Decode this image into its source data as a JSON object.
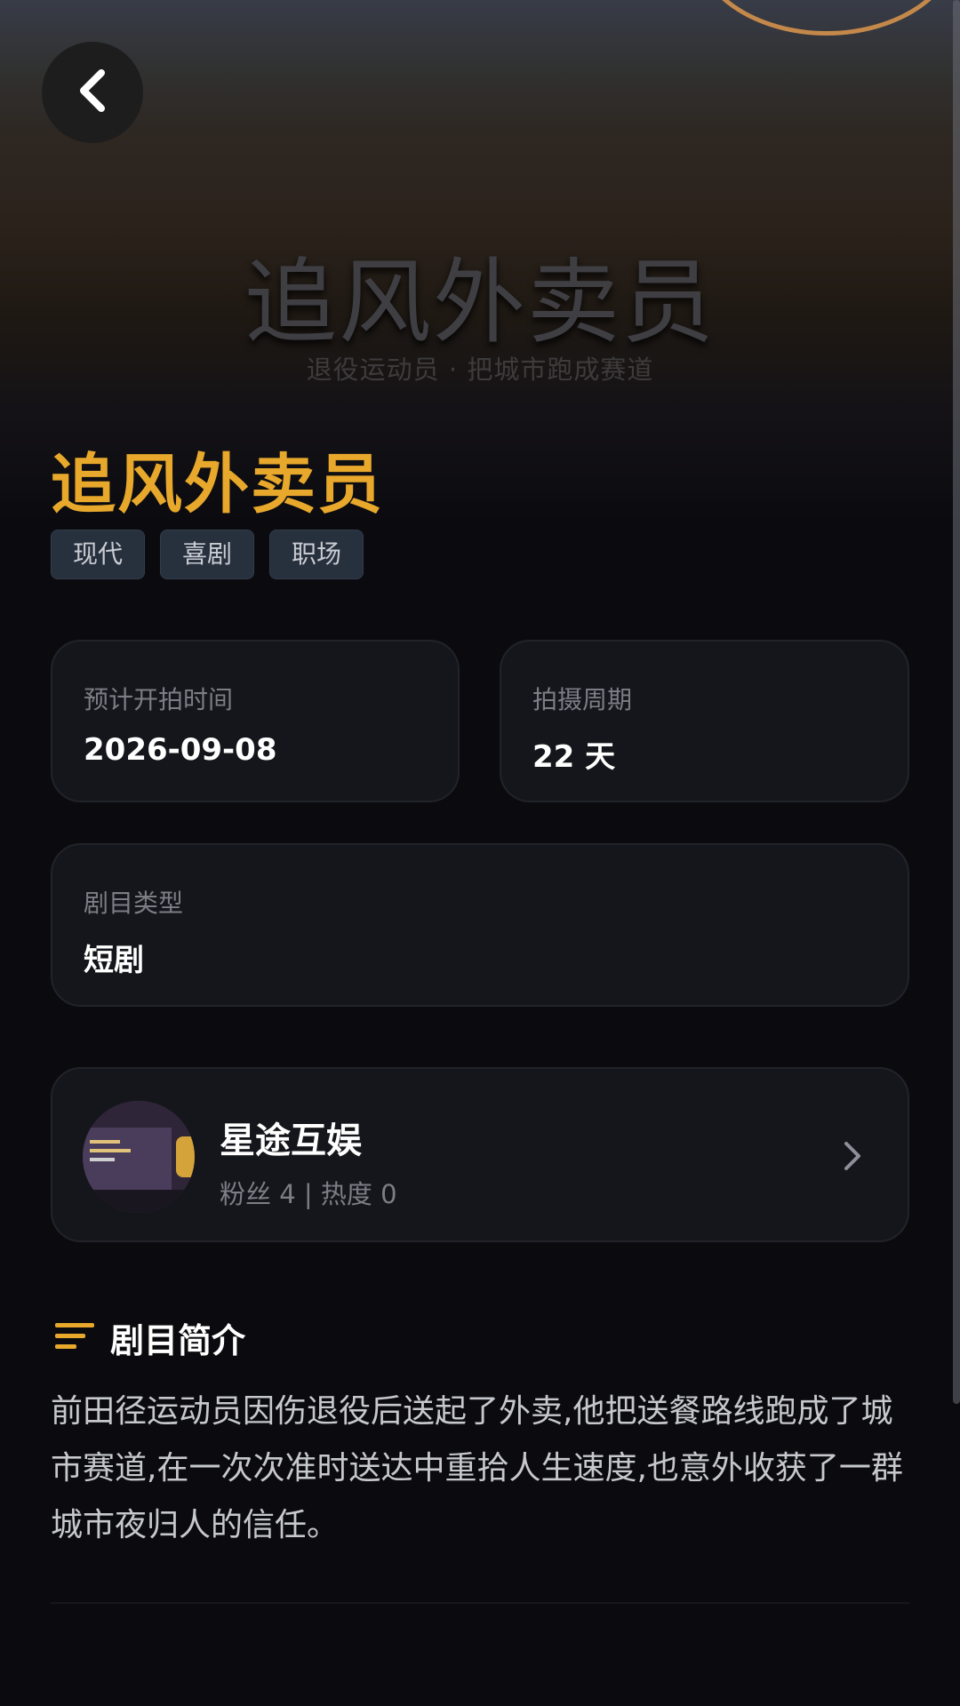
{
  "hero": {
    "title": "追风外卖员",
    "subtitle": "退役运动员 · 把城市跑成赛道"
  },
  "show": {
    "title": "追风外卖员",
    "tags": [
      "现代",
      "喜剧",
      "职场"
    ]
  },
  "info_cards": {
    "start_date": {
      "label": "预计开拍时间",
      "value": "2026-09-08"
    },
    "period": {
      "label": "拍摄周期",
      "value": "22 天"
    },
    "genre": {
      "label": "剧目类型",
      "value": "短剧"
    }
  },
  "studio": {
    "name": "星途互娱",
    "meta": "粉丝 4 | 热度 0"
  },
  "synopsis": {
    "heading": "剧目简介",
    "text": "前田径运动员因伤退役后送起了外卖,他把送餐路线跑成了城市赛道,在一次次准时送达中重拾人生速度,也意外收获了一群城市夜归人的信任。"
  },
  "icons": {
    "back": "chevron-left-icon",
    "studio_link": "chevron-right-icon",
    "section": "text-lines-icon"
  },
  "colors": {
    "accent": "#e7a82c",
    "background": "#0b0b0f",
    "card": "#15161b",
    "tag": "#27303d"
  }
}
